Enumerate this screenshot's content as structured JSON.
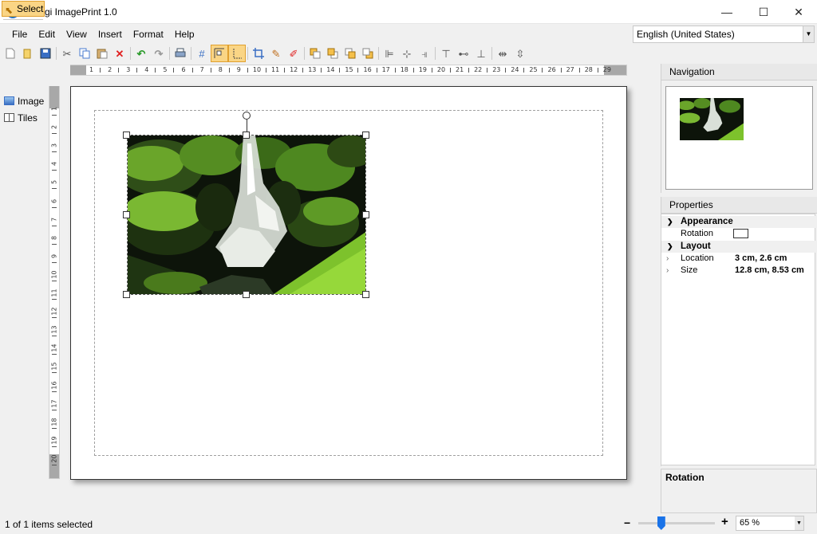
{
  "window": {
    "title": "Coragi ImagePrint 1.0",
    "minimize": "—",
    "maximize": "☐",
    "close": "✕"
  },
  "menu": [
    {
      "label": "File"
    },
    {
      "label": "Edit"
    },
    {
      "label": "View"
    },
    {
      "label": "Insert"
    },
    {
      "label": "Format"
    },
    {
      "label": "Help"
    }
  ],
  "language": {
    "value": "English (United States)"
  },
  "tools": {
    "select": "Select",
    "image": "Image",
    "tiles": "Tiles"
  },
  "hruler": {
    "ticks": [
      "1",
      "2",
      "3",
      "4",
      "5",
      "6",
      "7",
      "8",
      "9",
      "10",
      "11",
      "12",
      "13",
      "14",
      "15",
      "16",
      "17",
      "18",
      "19",
      "20",
      "21",
      "22",
      "23",
      "24",
      "25",
      "26",
      "27",
      "28",
      "29"
    ]
  },
  "vruler": {
    "ticks": [
      "1",
      "2",
      "3",
      "4",
      "5",
      "6",
      "7",
      "8",
      "9",
      "10",
      "11",
      "12",
      "13",
      "14",
      "15",
      "16",
      "17",
      "18",
      "19",
      "20"
    ]
  },
  "navigation": {
    "title": "Navigation"
  },
  "properties": {
    "title": "Properties",
    "appearance": {
      "label": "Appearance",
      "rotation_label": "Rotation"
    },
    "layout": {
      "label": "Layout",
      "location_label": "Location",
      "location_value": "3 cm, 2.6 cm",
      "size_label": "Size",
      "size_value": "12.8 cm, 8.53 cm"
    }
  },
  "description": {
    "title": "Rotation"
  },
  "status": {
    "selection": "1 of 1 items selected"
  },
  "zoom": {
    "minus": "−",
    "plus": "+",
    "value": "65 %",
    "level": 0.3
  },
  "colors": {
    "highlight": "#fad585",
    "accent": "#1a73e8"
  }
}
